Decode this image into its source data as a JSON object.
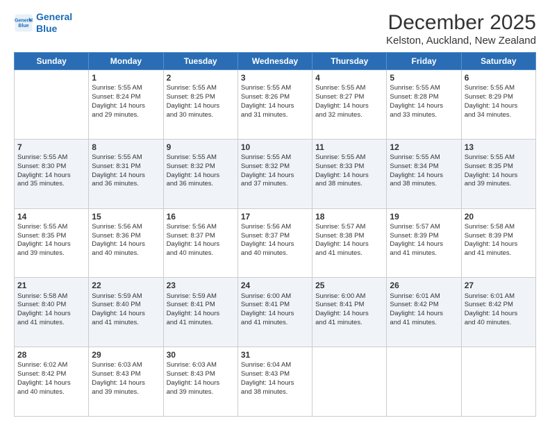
{
  "logo": {
    "line1": "General",
    "line2": "Blue"
  },
  "title": "December 2025",
  "location": "Kelston, Auckland, New Zealand",
  "days": [
    "Sunday",
    "Monday",
    "Tuesday",
    "Wednesday",
    "Thursday",
    "Friday",
    "Saturday"
  ],
  "weeks": [
    [
      {
        "day": "",
        "info": ""
      },
      {
        "day": "1",
        "info": "Sunrise: 5:55 AM\nSunset: 8:24 PM\nDaylight: 14 hours\nand 29 minutes."
      },
      {
        "day": "2",
        "info": "Sunrise: 5:55 AM\nSunset: 8:25 PM\nDaylight: 14 hours\nand 30 minutes."
      },
      {
        "day": "3",
        "info": "Sunrise: 5:55 AM\nSunset: 8:26 PM\nDaylight: 14 hours\nand 31 minutes."
      },
      {
        "day": "4",
        "info": "Sunrise: 5:55 AM\nSunset: 8:27 PM\nDaylight: 14 hours\nand 32 minutes."
      },
      {
        "day": "5",
        "info": "Sunrise: 5:55 AM\nSunset: 8:28 PM\nDaylight: 14 hours\nand 33 minutes."
      },
      {
        "day": "6",
        "info": "Sunrise: 5:55 AM\nSunset: 8:29 PM\nDaylight: 14 hours\nand 34 minutes."
      }
    ],
    [
      {
        "day": "7",
        "info": "Sunrise: 5:55 AM\nSunset: 8:30 PM\nDaylight: 14 hours\nand 35 minutes."
      },
      {
        "day": "8",
        "info": "Sunrise: 5:55 AM\nSunset: 8:31 PM\nDaylight: 14 hours\nand 36 minutes."
      },
      {
        "day": "9",
        "info": "Sunrise: 5:55 AM\nSunset: 8:32 PM\nDaylight: 14 hours\nand 36 minutes."
      },
      {
        "day": "10",
        "info": "Sunrise: 5:55 AM\nSunset: 8:32 PM\nDaylight: 14 hours\nand 37 minutes."
      },
      {
        "day": "11",
        "info": "Sunrise: 5:55 AM\nSunset: 8:33 PM\nDaylight: 14 hours\nand 38 minutes."
      },
      {
        "day": "12",
        "info": "Sunrise: 5:55 AM\nSunset: 8:34 PM\nDaylight: 14 hours\nand 38 minutes."
      },
      {
        "day": "13",
        "info": "Sunrise: 5:55 AM\nSunset: 8:35 PM\nDaylight: 14 hours\nand 39 minutes."
      }
    ],
    [
      {
        "day": "14",
        "info": "Sunrise: 5:55 AM\nSunset: 8:35 PM\nDaylight: 14 hours\nand 39 minutes."
      },
      {
        "day": "15",
        "info": "Sunrise: 5:56 AM\nSunset: 8:36 PM\nDaylight: 14 hours\nand 40 minutes."
      },
      {
        "day": "16",
        "info": "Sunrise: 5:56 AM\nSunset: 8:37 PM\nDaylight: 14 hours\nand 40 minutes."
      },
      {
        "day": "17",
        "info": "Sunrise: 5:56 AM\nSunset: 8:37 PM\nDaylight: 14 hours\nand 40 minutes."
      },
      {
        "day": "18",
        "info": "Sunrise: 5:57 AM\nSunset: 8:38 PM\nDaylight: 14 hours\nand 41 minutes."
      },
      {
        "day": "19",
        "info": "Sunrise: 5:57 AM\nSunset: 8:39 PM\nDaylight: 14 hours\nand 41 minutes."
      },
      {
        "day": "20",
        "info": "Sunrise: 5:58 AM\nSunset: 8:39 PM\nDaylight: 14 hours\nand 41 minutes."
      }
    ],
    [
      {
        "day": "21",
        "info": "Sunrise: 5:58 AM\nSunset: 8:40 PM\nDaylight: 14 hours\nand 41 minutes."
      },
      {
        "day": "22",
        "info": "Sunrise: 5:59 AM\nSunset: 8:40 PM\nDaylight: 14 hours\nand 41 minutes."
      },
      {
        "day": "23",
        "info": "Sunrise: 5:59 AM\nSunset: 8:41 PM\nDaylight: 14 hours\nand 41 minutes."
      },
      {
        "day": "24",
        "info": "Sunrise: 6:00 AM\nSunset: 8:41 PM\nDaylight: 14 hours\nand 41 minutes."
      },
      {
        "day": "25",
        "info": "Sunrise: 6:00 AM\nSunset: 8:41 PM\nDaylight: 14 hours\nand 41 minutes."
      },
      {
        "day": "26",
        "info": "Sunrise: 6:01 AM\nSunset: 8:42 PM\nDaylight: 14 hours\nand 41 minutes."
      },
      {
        "day": "27",
        "info": "Sunrise: 6:01 AM\nSunset: 8:42 PM\nDaylight: 14 hours\nand 40 minutes."
      }
    ],
    [
      {
        "day": "28",
        "info": "Sunrise: 6:02 AM\nSunset: 8:42 PM\nDaylight: 14 hours\nand 40 minutes."
      },
      {
        "day": "29",
        "info": "Sunrise: 6:03 AM\nSunset: 8:43 PM\nDaylight: 14 hours\nand 39 minutes."
      },
      {
        "day": "30",
        "info": "Sunrise: 6:03 AM\nSunset: 8:43 PM\nDaylight: 14 hours\nand 39 minutes."
      },
      {
        "day": "31",
        "info": "Sunrise: 6:04 AM\nSunset: 8:43 PM\nDaylight: 14 hours\nand 38 minutes."
      },
      {
        "day": "",
        "info": ""
      },
      {
        "day": "",
        "info": ""
      },
      {
        "day": "",
        "info": ""
      }
    ]
  ]
}
